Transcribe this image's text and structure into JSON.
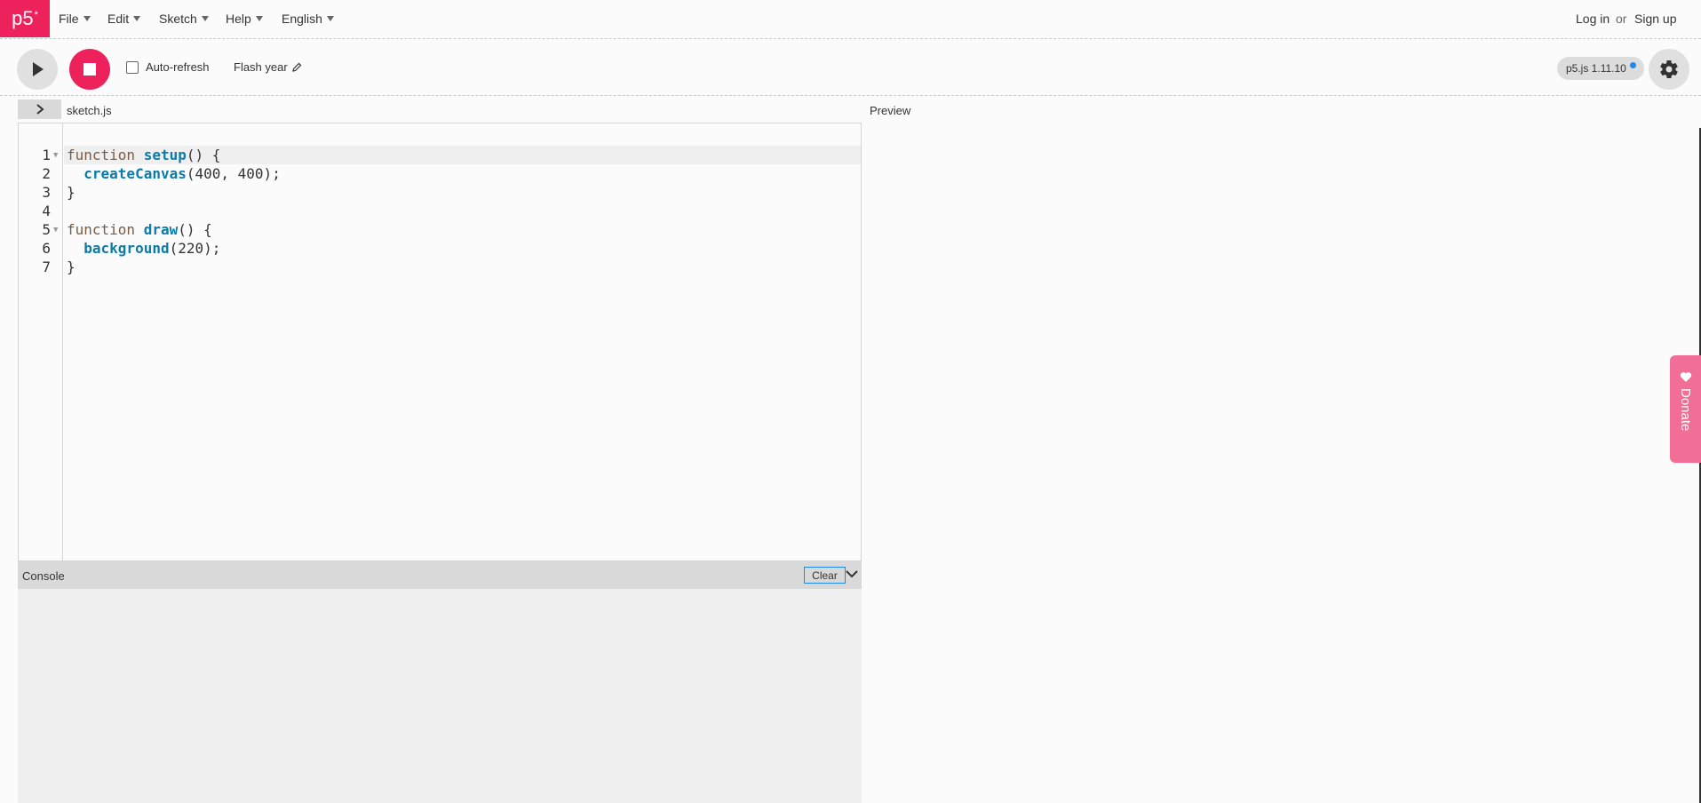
{
  "nav": {
    "logo": "p5",
    "logo_mark": "*",
    "menus": [
      "File",
      "Edit",
      "Sketch",
      "Help",
      "English"
    ],
    "login": "Log in",
    "or": "or",
    "signup": "Sign up"
  },
  "toolbar": {
    "autorefresh_label": "Auto-refresh",
    "autorefresh_checked": false,
    "sketch_name": "Flash year",
    "version": "p5.js 1.11.10"
  },
  "editor": {
    "filename": "sketch.js",
    "preview_label": "Preview",
    "lines": [
      {
        "n": "1",
        "fold": true
      },
      {
        "n": "2",
        "fold": false
      },
      {
        "n": "3",
        "fold": false
      },
      {
        "n": "4",
        "fold": false
      },
      {
        "n": "5",
        "fold": true
      },
      {
        "n": "6",
        "fold": false
      },
      {
        "n": "7",
        "fold": false
      }
    ],
    "code": {
      "l1_kw": "function",
      "l1_fn": "setup",
      "l1_rest": "() {",
      "l2_fn": "createCanvas",
      "l2_rest": "(400, 400);",
      "l3": "}",
      "l5_kw": "function",
      "l5_fn": "draw",
      "l5_rest": "() {",
      "l6_fn": "background",
      "l6_rest": "(220);",
      "l7": "}"
    }
  },
  "console": {
    "title": "Console",
    "clear": "Clear"
  },
  "donate": {
    "label": "Donate"
  },
  "colors": {
    "brand": "#ed225d",
    "donate": "#f16f97",
    "accent_blue": "#1d8af0"
  }
}
